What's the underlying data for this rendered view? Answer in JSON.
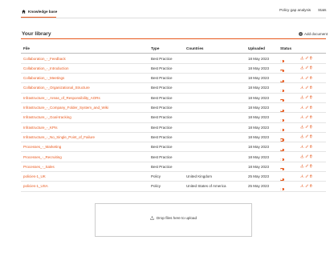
{
  "nav": {
    "home_label": "Knowledge base",
    "policy_gap_label": "Policy gap analysis",
    "stats_label": "Stats"
  },
  "library": {
    "title": "Your library",
    "add_document_label": "Add document"
  },
  "table": {
    "headers": {
      "file": "File",
      "type": "Type",
      "countries": "Countries",
      "uploaded": "Uploaded",
      "status": "Status"
    },
    "rows": [
      {
        "file": "Collaboration_-_Feedback",
        "type": "Best Practice",
        "country": "",
        "uploaded": "18 May 2023"
      },
      {
        "file": "Collaboration_-_Introduction",
        "type": "Best Practice",
        "country": "",
        "uploaded": "18 May 2023"
      },
      {
        "file": "Collaboration_-_Meetings",
        "type": "Best Practice",
        "country": "",
        "uploaded": "18 May 2023"
      },
      {
        "file": "Collaboration_-_Organizational_Structure",
        "type": "Best Practice",
        "country": "",
        "uploaded": "18 May 2023"
      },
      {
        "file": "Infrastructure_-_Areas_of_Responsibility_AORs",
        "type": "Best Practice",
        "country": "",
        "uploaded": "18 May 2023"
      },
      {
        "file": "Infrastructure_-_Company_Folder_System_and_Wiki",
        "type": "Best Practice",
        "country": "",
        "uploaded": "18 May 2023"
      },
      {
        "file": "Infrastructure_-_Goal-tracking",
        "type": "Best Practice",
        "country": "",
        "uploaded": "18 May 2023"
      },
      {
        "file": "Infrastructure_-_KPIs",
        "type": "Best Practice",
        "country": "",
        "uploaded": "18 May 2023"
      },
      {
        "file": "Infrastructure_-_No_Single_Point_of_Failure",
        "type": "Best Practice",
        "country": "",
        "uploaded": "18 May 2023"
      },
      {
        "file": "Processes_-_Marketing",
        "type": "Best Practice",
        "country": "",
        "uploaded": "18 May 2023"
      },
      {
        "file": "Processes_-_Recruiting",
        "type": "Best Practice",
        "country": "",
        "uploaded": "18 May 2023"
      },
      {
        "file": "Processes_-_Sales",
        "type": "Best Practice",
        "country": "",
        "uploaded": "18 May 2023"
      },
      {
        "file": "policies-1_UK",
        "type": "Policy",
        "country": "United Kingdom",
        "uploaded": "25 May 2023"
      },
      {
        "file": "policies-1_USA",
        "type": "Policy",
        "country": "United States of America",
        "uploaded": "25 May 2023"
      }
    ]
  },
  "status_colors": {
    "ready": "#2e9e4f",
    "toggle": "#e8581c"
  },
  "accent_color": "#e8581c",
  "row_icons": [
    "download-icon",
    "edit-icon",
    "delete-icon"
  ],
  "dropzone": {
    "label": "Drop files here to upload"
  }
}
